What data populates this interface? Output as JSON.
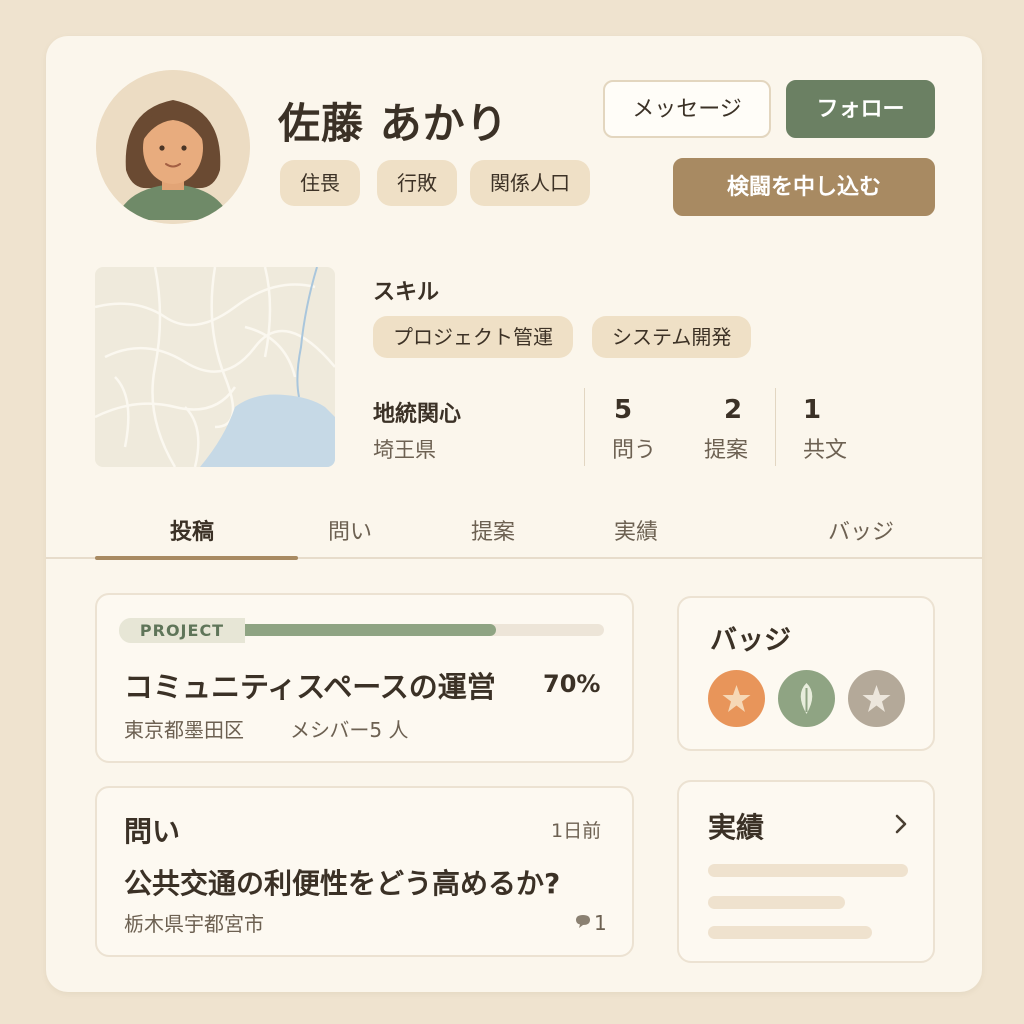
{
  "profile": {
    "name": "佐藤 あかり",
    "tags": [
      "住畏",
      "行敗",
      "関係人口"
    ]
  },
  "actions": {
    "message": "メッセージ",
    "follow": "フォロー",
    "apply": "検闘を中し込む"
  },
  "skills": {
    "title": "スキル",
    "items": [
      "プロジェクト管運",
      "システム開発"
    ]
  },
  "interest": {
    "title": "地統関心",
    "value": "埼王県"
  },
  "stats": [
    {
      "value": "5",
      "label": "問う"
    },
    {
      "value": "2",
      "label": "提案"
    },
    {
      "value": "1",
      "label": "共文"
    }
  ],
  "tabs": [
    "投稿",
    "問い",
    "提案",
    "実績",
    "バッジ"
  ],
  "project": {
    "tag": "PROJECT",
    "title": "コミュニティスペースの運営",
    "progress_pct": 70,
    "progress_text": "70%",
    "location": "東京都墨田区",
    "members": "メシバー5 人"
  },
  "question": {
    "label": "問い",
    "time": "1日前",
    "title": "公共交通の利便性をどう高めるか?",
    "location": "栃木県宇都宮市",
    "comments": "1"
  },
  "badges": {
    "title": "バッジ",
    "items": [
      {
        "icon": "star-icon",
        "color": "#e8955a"
      },
      {
        "icon": "leaf-icon",
        "color": "#8fa483"
      },
      {
        "icon": "star-icon",
        "color": "#b4a999"
      }
    ]
  },
  "achievements": {
    "title": "実績"
  },
  "colors": {
    "accent_green": "#6b8063",
    "accent_brown": "#a88a62",
    "background": "#efe3cf"
  }
}
